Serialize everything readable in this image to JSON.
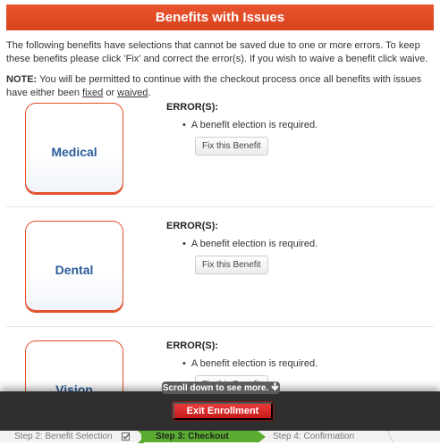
{
  "header": {
    "title": "Benefits with Issues"
  },
  "intro": {
    "text": "The following benefits have selections that cannot be saved due to one or more errors. To keep these benefits please click 'Fix' and correct the error(s). If you wish to waive a benefit click waive."
  },
  "note": {
    "label": "NOTE:",
    "text_before": " You will be permitted to continue with the checkout process once all benefits with issues have either been ",
    "fixed_link": "fixed",
    "text_middle": " or ",
    "waived_link": "waived",
    "text_after": "."
  },
  "benefits": [
    {
      "name": "Medical",
      "errors_title": "ERROR(S):",
      "error": "A benefit election is required.",
      "fix_label": "Fix this Benefit"
    },
    {
      "name": "Dental",
      "errors_title": "ERROR(S):",
      "error": "A benefit election is required.",
      "fix_label": "Fix this Benefit"
    },
    {
      "name": "Vision",
      "errors_title": "ERROR(S):",
      "error": "A benefit election is required.",
      "fix_label": "Fix this Benefit"
    }
  ],
  "scroll_hint": {
    "text": "Scroll down to see more.",
    "icon": "arrow-down-icon"
  },
  "footer": {
    "exit_label": "Exit Enrollment"
  },
  "steps": {
    "step2": "Step 2: Benefit Selection",
    "step2_status_icon": "checkbox-checked-icon",
    "step3": "Step 3: Checkout",
    "step4": "Step 4: Confirmation"
  },
  "colors": {
    "header": "#d9441f",
    "card_border": "#e2502b",
    "card_text": "#2b5d9b",
    "exit": "#d42424",
    "active_step": "#5aac31"
  }
}
